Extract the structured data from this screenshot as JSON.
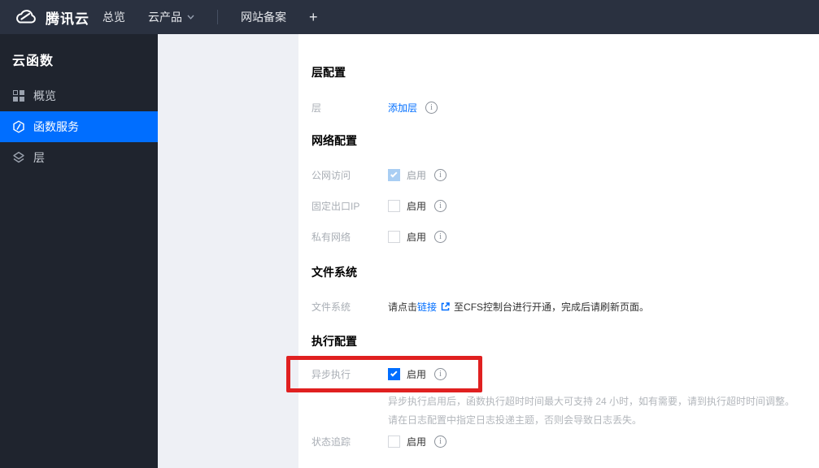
{
  "topbar": {
    "brand": "腾讯云",
    "nav_overview": "总览",
    "nav_products": "云产品",
    "nav_icp": "网站备案",
    "nav_add": "+"
  },
  "sidebar": {
    "title": "云函数",
    "items": [
      {
        "label": "概览",
        "icon": "grid-icon",
        "active": false
      },
      {
        "label": "函数服务",
        "icon": "function-icon",
        "active": true
      },
      {
        "label": "层",
        "icon": "layers-icon",
        "active": false
      }
    ]
  },
  "content": {
    "layer_section": {
      "heading": "层配置",
      "layer_label": "层",
      "add_layer_link": "添加层"
    },
    "network_section": {
      "heading": "网络配置",
      "rows": [
        {
          "label": "公网访问",
          "state": "checked-disabled",
          "value": "启用"
        },
        {
          "label": "固定出口IP",
          "state": "unchecked",
          "value": "启用"
        },
        {
          "label": "私有网络",
          "state": "unchecked",
          "value": "启用"
        }
      ]
    },
    "filesystem_section": {
      "heading": "文件系统",
      "label": "文件系统",
      "text_before": "请点击",
      "link": "链接",
      "text_after": "至CFS控制台进行开通，完成后请刷新页面。"
    },
    "execution_section": {
      "heading": "执行配置",
      "async_row": {
        "label": "异步执行",
        "state": "checked",
        "value": "启用"
      },
      "help_line1": "异步执行启用后，函数执行超时时间最大可支持 24 小时，如有需要，请到执行超时时间调整。",
      "help_line2": "请在日志配置中指定日志投递主题，否则会导致日志丢失。",
      "status_row": {
        "label": "状态追踪",
        "state": "unchecked",
        "value": "启用"
      }
    }
  },
  "colors": {
    "accent_blue": "#006eff",
    "annotation_red": "#e02020",
    "topbar_bg": "#2a3140",
    "sidebar_bg": "#1f242e",
    "subpanel_bg": "#eef0f5"
  }
}
